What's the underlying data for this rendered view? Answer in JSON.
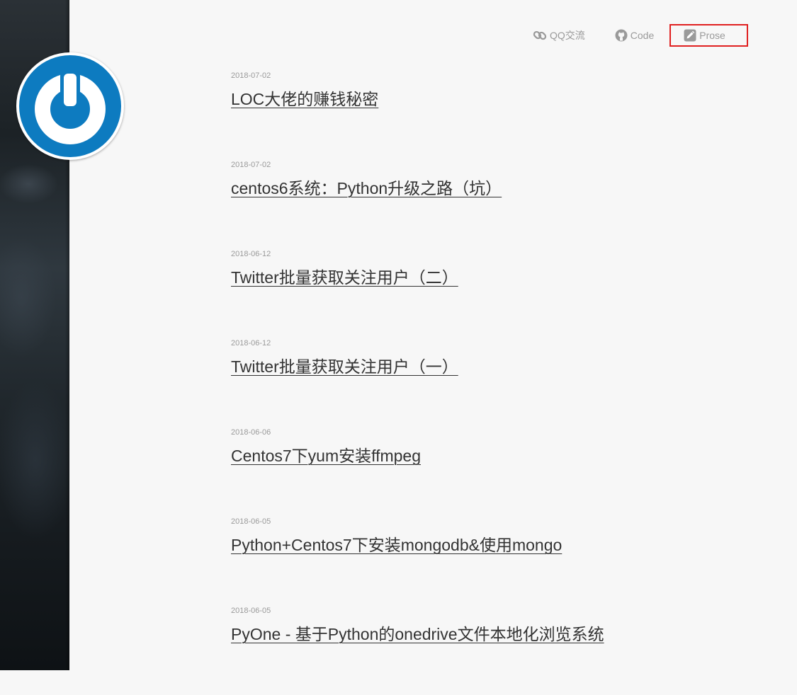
{
  "nav": {
    "qq_label": "QQ交流",
    "code_label": "Code",
    "prose_label": "Prose",
    "qq_icon": "link-icon",
    "code_icon": "github-icon",
    "prose_icon": "pencil-icon",
    "highlight_color": "#e02020"
  },
  "avatar": {
    "icon": "power-icon",
    "color": "#0d7bc0"
  },
  "posts": [
    {
      "date": "2018-07-02",
      "title": "LOC大佬的赚钱秘密"
    },
    {
      "date": "2018-07-02",
      "title": "centos6系统：Python升级之路（坑）"
    },
    {
      "date": "2018-06-12",
      "title": "Twitter批量获取关注用户（二）"
    },
    {
      "date": "2018-06-12",
      "title": "Twitter批量获取关注用户（一）"
    },
    {
      "date": "2018-06-06",
      "title": "Centos7下yum安装ffmpeg"
    },
    {
      "date": "2018-06-05",
      "title": "Python+Centos7下安装mongodb&使用mongo"
    },
    {
      "date": "2018-06-05",
      "title": "PyOne - 基于Python的onedrive文件本地化浏览系统"
    }
  ]
}
